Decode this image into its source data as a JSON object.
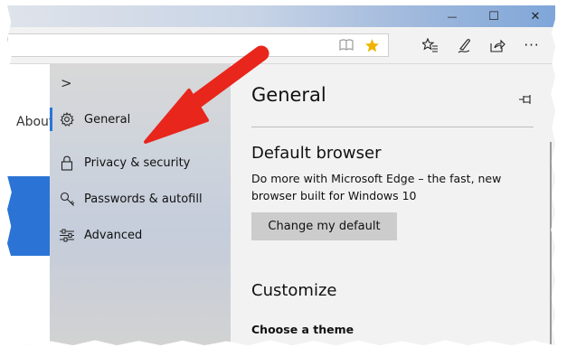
{
  "window": {
    "minimize_glyph": "—",
    "maximize_glyph": "☐",
    "close_glyph": "✕"
  },
  "toolbar": {
    "icons": [
      "reading-view-icon",
      "favorite-star-icon",
      "favorites-hub-icon",
      "web-note-icon",
      "share-icon",
      "more-icon"
    ],
    "star_color": "#f0b400",
    "more_glyph": "···"
  },
  "background_page": {
    "about_text": "About",
    "banner_color": "#2b74d6"
  },
  "settings": {
    "expand_glyph": ">",
    "nav_items": [
      {
        "label": "General",
        "icon": "gear-icon"
      },
      {
        "label": "Privacy & security",
        "icon": "lock-icon"
      },
      {
        "label": "Passwords & autofill",
        "icon": "key-icon"
      },
      {
        "label": "Advanced",
        "icon": "sliders-icon"
      }
    ],
    "selected_index": 0,
    "pane_title": "General",
    "default_browser": {
      "heading": "Default browser",
      "description": "Do more with Microsoft Edge – the fast, new browser built for Windows 10",
      "button_label": "Change my default"
    },
    "customize": {
      "heading": "Customize",
      "subheading": "Choose a theme"
    }
  },
  "annotation": {
    "arrow_color": "#e8261c"
  }
}
